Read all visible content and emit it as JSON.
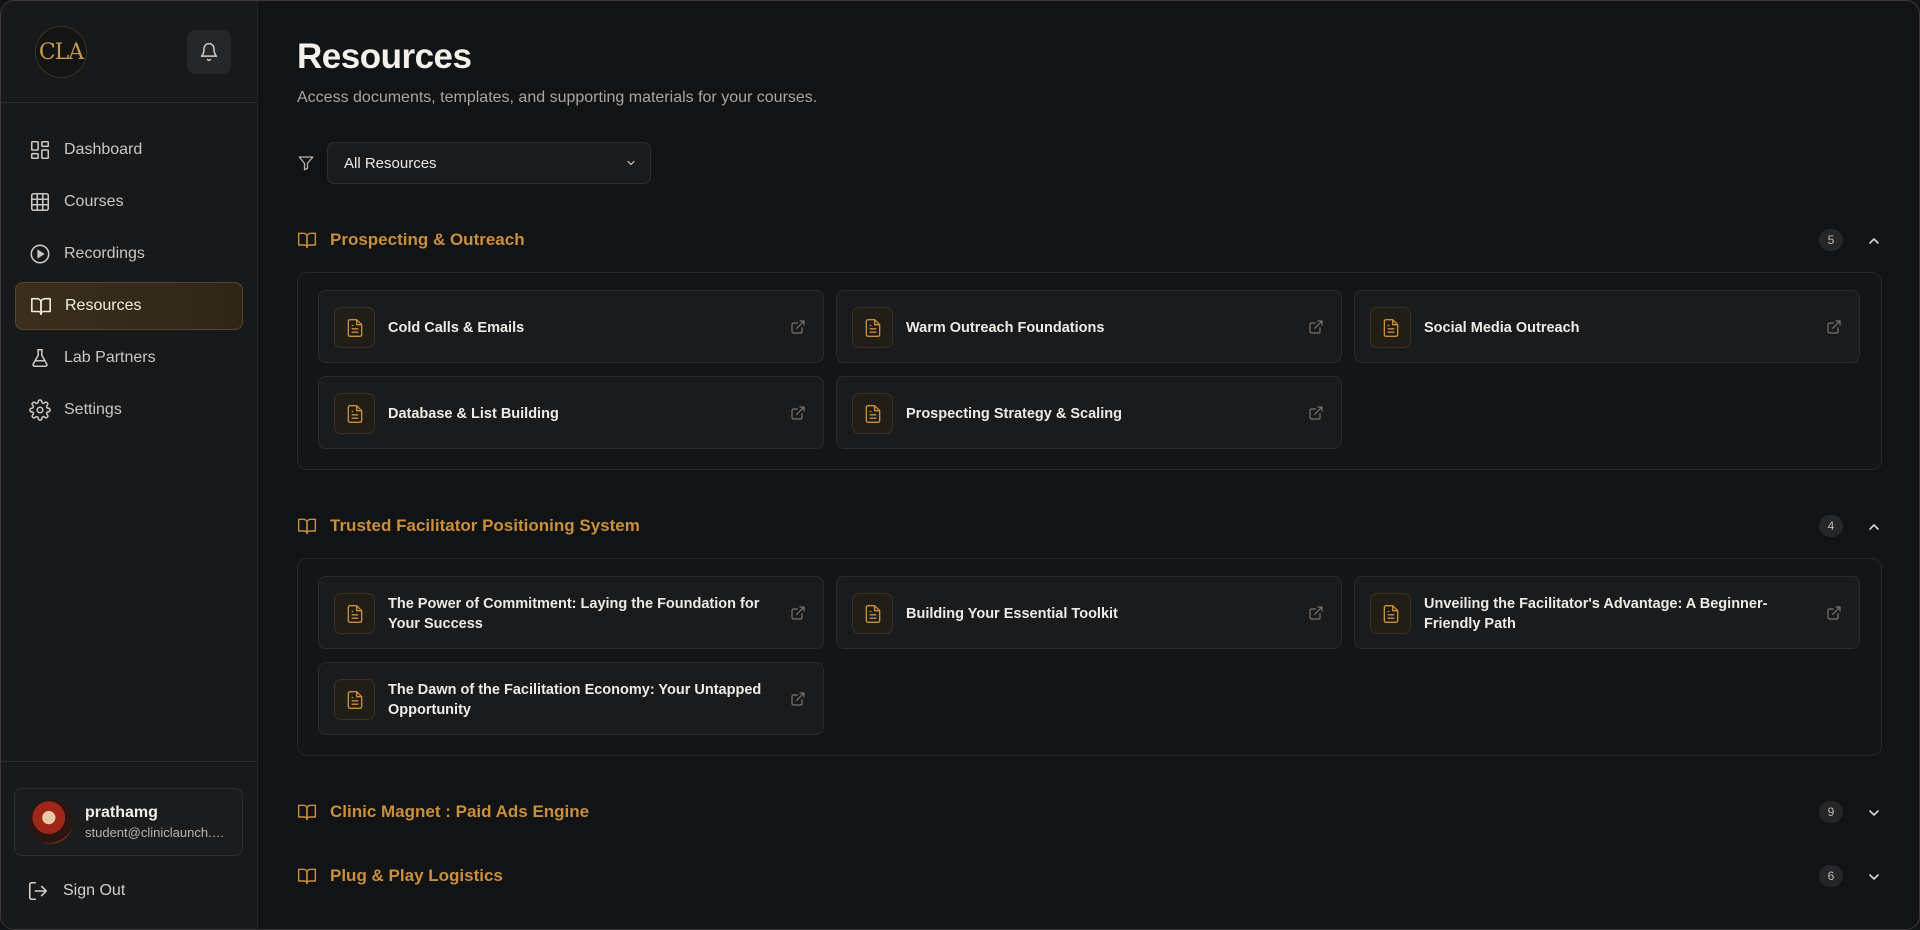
{
  "app": {
    "logo_text": "CLA"
  },
  "sidebar": {
    "items": [
      {
        "label": "Dashboard",
        "icon": "dashboard-icon"
      },
      {
        "label": "Courses",
        "icon": "grid-icon"
      },
      {
        "label": "Recordings",
        "icon": "play-circle-icon"
      },
      {
        "label": "Resources",
        "icon": "book-open-icon",
        "active": true
      },
      {
        "label": "Lab Partners",
        "icon": "flask-icon"
      },
      {
        "label": "Settings",
        "icon": "gear-icon"
      }
    ],
    "user": {
      "name": "prathamg",
      "email": "student@cliniclaunch.com"
    },
    "signout_label": "Sign Out"
  },
  "main": {
    "title": "Resources",
    "subtitle": "Access documents, templates, and supporting materials for your courses.",
    "filter": {
      "selected": "All Resources"
    },
    "sections": [
      {
        "title": "Prospecting & Outreach",
        "count": "5",
        "expanded": true,
        "items": [
          "Cold Calls & Emails",
          "Warm Outreach Foundations",
          "Social Media Outreach",
          "Database & List Building",
          "Prospecting Strategy & Scaling"
        ]
      },
      {
        "title": "Trusted Facilitator Positioning System",
        "count": "4",
        "expanded": true,
        "items": [
          "The Power of Commitment: Laying the Foundation for Your Success",
          "Building Your Essential Toolkit",
          "Unveiling the Facilitator's Advantage: A Beginner-Friendly Path",
          "The Dawn of the Facilitation Economy: Your Untapped Opportunity"
        ]
      },
      {
        "title": "Clinic Magnet : Paid Ads Engine",
        "count": "9",
        "expanded": false
      },
      {
        "title": "Plug & Play Logistics",
        "count": "6",
        "expanded": false
      }
    ]
  },
  "colors": {
    "accent": "#c98f3a",
    "background": "#121314",
    "sidebar": "#18191b"
  }
}
